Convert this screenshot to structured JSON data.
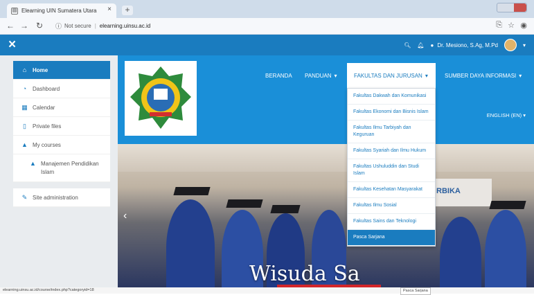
{
  "browser": {
    "tab_title": "Elearning UIN Sumatera Utara",
    "tab_close": "×",
    "new_tab": "+",
    "not_secure": "Not secure",
    "url": "elearning.uinsu.ac.id"
  },
  "topnav": {
    "menu_icon": "×",
    "user_name": "Dr. Mesiono, S.Ag, M.Pd"
  },
  "sidebar": {
    "items": [
      {
        "label": "Home",
        "icon": "home-icon",
        "glyph": "⌂"
      },
      {
        "label": "Dashboard",
        "icon": "dashboard-icon",
        "glyph": "◔"
      },
      {
        "label": "Calendar",
        "icon": "calendar-icon",
        "glyph": "▦"
      },
      {
        "label": "Private files",
        "icon": "file-icon",
        "glyph": "▯"
      },
      {
        "label": "My courses",
        "icon": "graduation-cap-icon",
        "glyph": "▲"
      },
      {
        "label": "Manajemen Pendidikan Islam",
        "icon": "graduation-cap-icon",
        "glyph": "▲"
      }
    ],
    "admin": {
      "label": "Site administration",
      "icon": "wrench-icon",
      "glyph": "✎"
    }
  },
  "menu": {
    "beranda": "BERANDA",
    "panduan": "PANDUAN",
    "fakultas": "FAKULTAS DAN JURUSAN",
    "sumber": "SUMBER DAYA INFORMASI",
    "language": "ENGLISH (EN)"
  },
  "dropdown": [
    "Fakultas Dakwah dan Komunikasi",
    "Fakultas Ekonomi dan Bisnis Islam",
    "Fakultas Ilmu Tarbiyah dan Keguruan",
    "Fakultas Syariah dan Ilmu Hukum",
    "Fakultas Ushuluddin dan Studi Islam",
    "Fakultas Kesehatan Masyarakat",
    "Fakultas Ilmu Sosial",
    "Fakultas Sains dan Teknologi",
    "Pasca Sarjana"
  ],
  "hero": {
    "title": "Wisuda Sa",
    "banner": "RBIKA"
  },
  "status": {
    "link": "elearning.uinsu.ac.id/course/index.php?categoryid=18",
    "tooltip": "Pasca Sarjana"
  },
  "colors": {
    "primary": "#1a7cbf",
    "header": "#1a8fd8",
    "sidebar_bg": "#e9ecef"
  }
}
